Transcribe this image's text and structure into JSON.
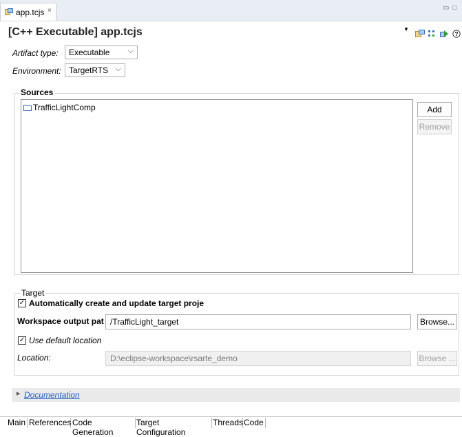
{
  "editor_tab": {
    "label": "app.tcjs",
    "close": "×"
  },
  "window_controls": {
    "minimize": "▭",
    "maximize": "□"
  },
  "header": {
    "title": "[C++ Executable] app.tcjs",
    "menu": "▼"
  },
  "artifact": {
    "label": "Artifact type:",
    "value": "Executable"
  },
  "environment": {
    "label": "Environment:",
    "value": "TargetRTS"
  },
  "sources": {
    "title": "Sources",
    "items": [
      "TrafficLightComp"
    ],
    "add_label": "Add",
    "remove_label": "Remove"
  },
  "target": {
    "title": "Target",
    "auto_create_label": "Automatically create and update target proje",
    "auto_create_checked": true,
    "workspace_output_label": "Workspace output pat",
    "workspace_output_value": "/TrafficLight_target",
    "browse_label": "Browse...",
    "use_default_label": "Use default location",
    "use_default_checked": true,
    "location_label": "Location:",
    "location_value": "D:\\eclipse-workspace\\rsarte_demo",
    "browse_disabled_label": "Browse ..."
  },
  "documentation": {
    "label": "Documentation"
  },
  "bottom_tabs": [
    "Main",
    "References",
    "Code Generation",
    "Target Configuration",
    "Threads",
    "Code"
  ],
  "colors": {
    "accent": "#1f5fbf",
    "tabbar_bg": "#e9eef5"
  }
}
